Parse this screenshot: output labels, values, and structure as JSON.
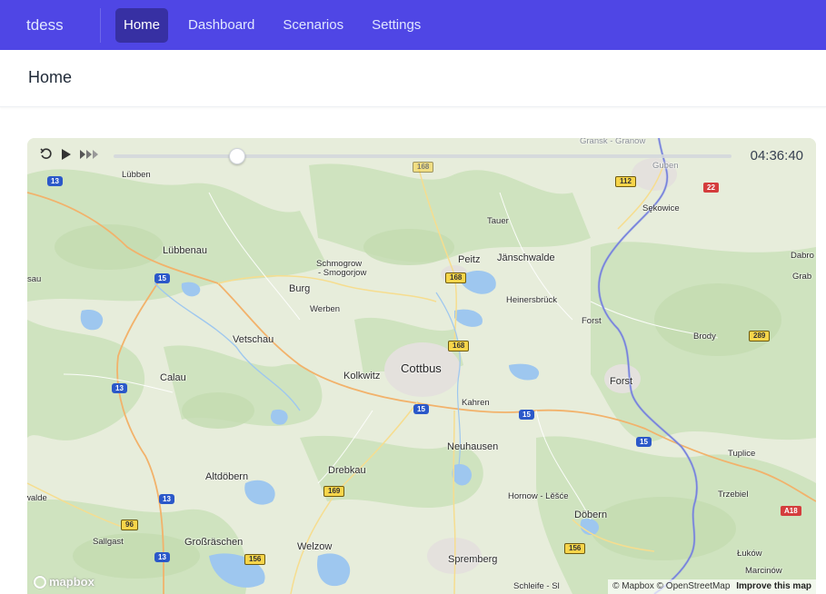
{
  "nav": {
    "brand": "tdess",
    "links": [
      {
        "label": "Home",
        "active": true
      },
      {
        "label": "Dashboard",
        "active": false
      },
      {
        "label": "Scenarios",
        "active": false
      },
      {
        "label": "Settings",
        "active": false
      }
    ]
  },
  "page": {
    "title": "Home"
  },
  "playback": {
    "time": "04:36:40",
    "progress": 0.2,
    "icons": [
      "reset-icon",
      "play-icon",
      "fast-forward-icon"
    ]
  },
  "map": {
    "places": {
      "cottbus": "Cottbus",
      "luebben": "Lübben",
      "luebbenau": "Lübbenau",
      "burg": "Burg",
      "schmogrow": "Schmogrow",
      "smogorjow": "- Smogorjow",
      "werben": "Werben",
      "vetschau": "Vetschau",
      "calau": "Calau",
      "kolkwitz": "Kolkwitz",
      "peitz": "Peitz",
      "jaenschwalde": "Jänschwalde",
      "tauer": "Tauer",
      "heinersbrueck": "Heinersbrück",
      "forst_upper": "Forst",
      "forst": "Forst",
      "kahren": "Kahren",
      "neuhausen": "Neuhausen",
      "drebkau": "Drebkau",
      "altdoebern": "Altdöbern",
      "hornow": "Hornow - Lěšće",
      "doebern": "Döbern",
      "spremberg": "Spremberg",
      "welzow": "Welzow",
      "grossraeschen": "Großräschen",
      "sallgast": "Sallgast",
      "guben": "Guben",
      "gubin_top": "Gransk - Granow",
      "sekowice": "Sękowice",
      "brody": "Brody",
      "tuplice": "Tuplice",
      "trzebiel": "Trzebiel",
      "lukow": "Łuków",
      "marcinow": "Marcinów",
      "schleife": "Schleife - Sl",
      "dabro": "Dabro",
      "grab": "Grab",
      "sau": "sau",
      "walde": "walde"
    },
    "shields": {
      "b13a": "13",
      "b13b": "13",
      "b13c": "13",
      "b13d": "13",
      "b15a": "15",
      "b15b": "15",
      "b15c": "15",
      "b15d": "15",
      "y168a": "168",
      "y168b": "168",
      "y168c": "168",
      "y112": "112",
      "y169": "169",
      "y96": "96",
      "y156a": "156",
      "y156b": "156",
      "y289": "289",
      "r22": "22",
      "rA18": "A18"
    },
    "logo": "mapbox",
    "attribution": {
      "mapbox": "© Mapbox",
      "osm": "© OpenStreetMap",
      "improve": "Improve this map"
    }
  }
}
